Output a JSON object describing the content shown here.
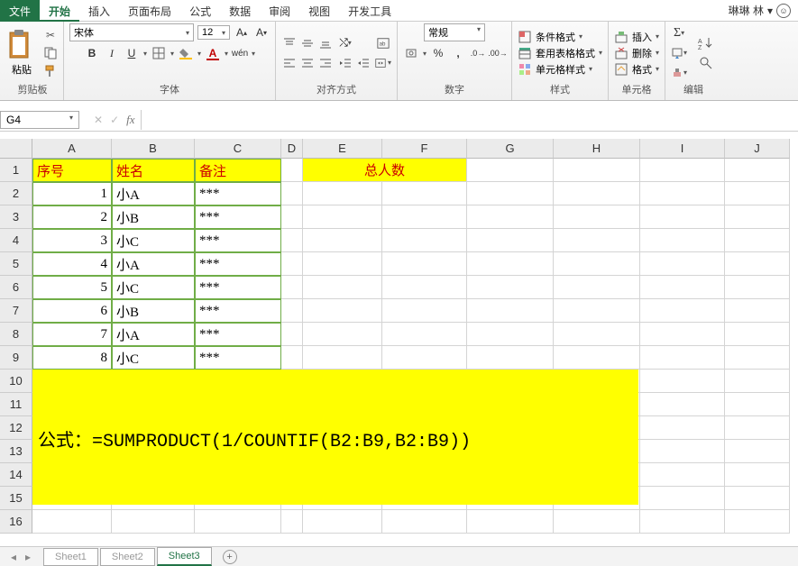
{
  "tabs": {
    "file": "文件",
    "home": "开始",
    "insert": "插入",
    "pageLayout": "页面布局",
    "formulas": "公式",
    "data": "数据",
    "review": "审阅",
    "view": "视图",
    "devTools": "开发工具"
  },
  "user": {
    "name": "琳琳 林"
  },
  "ribbon": {
    "clipboard": {
      "paste": "粘贴",
      "label": "剪贴板"
    },
    "font": {
      "name": "宋体",
      "size": "12",
      "bold": "B",
      "italic": "I",
      "underline": "U",
      "wen": "wén",
      "label": "字体"
    },
    "alignment": {
      "label": "对齐方式"
    },
    "number": {
      "format": "常规",
      "label": "数字"
    },
    "styles": {
      "cond": "条件格式",
      "table": "套用表格格式",
      "cell": "单元格样式",
      "label": "样式"
    },
    "cells": {
      "insert": "插入",
      "delete": "删除",
      "format": "格式",
      "label": "单元格"
    },
    "editing": {
      "label": "编辑"
    }
  },
  "nameBox": "G4",
  "colHeaders": [
    "A",
    "B",
    "C",
    "D",
    "E",
    "F",
    "G",
    "H",
    "I",
    "J"
  ],
  "rowHeaders": [
    "1",
    "2",
    "3",
    "4",
    "5",
    "6",
    "7",
    "8",
    "9",
    "10",
    "11",
    "12",
    "13",
    "14",
    "15",
    "16"
  ],
  "headers": {
    "col1": "序号",
    "col2": "姓名",
    "col3": "备注"
  },
  "total": "总人数",
  "rows": [
    {
      "n": "1",
      "name": "小A",
      "note": "***"
    },
    {
      "n": "2",
      "name": "小B",
      "note": "***"
    },
    {
      "n": "3",
      "name": "小C",
      "note": "***"
    },
    {
      "n": "4",
      "name": "小A",
      "note": "***"
    },
    {
      "n": "5",
      "name": "小C",
      "note": "***"
    },
    {
      "n": "6",
      "name": "小B",
      "note": "***"
    },
    {
      "n": "7",
      "name": "小A",
      "note": "***"
    },
    {
      "n": "8",
      "name": "小C",
      "note": "***"
    }
  ],
  "formula": "公式：=SUMPRODUCT(1/COUNTIF(B2:B9,B2:B9))",
  "sheets": {
    "s1": "Sheet1",
    "s2": "Sheet2",
    "s3": "Sheet3"
  },
  "chart_data": {
    "type": "table",
    "title": "总人数",
    "columns": [
      "序号",
      "姓名",
      "备注"
    ],
    "rows": [
      [
        1,
        "小A",
        "***"
      ],
      [
        2,
        "小B",
        "***"
      ],
      [
        3,
        "小C",
        "***"
      ],
      [
        4,
        "小A",
        "***"
      ],
      [
        5,
        "小C",
        "***"
      ],
      [
        6,
        "小B",
        "***"
      ],
      [
        7,
        "小A",
        "***"
      ],
      [
        8,
        "小C",
        "***"
      ]
    ],
    "formula": "=SUMPRODUCT(1/COUNTIF(B2:B9,B2:B9))"
  }
}
